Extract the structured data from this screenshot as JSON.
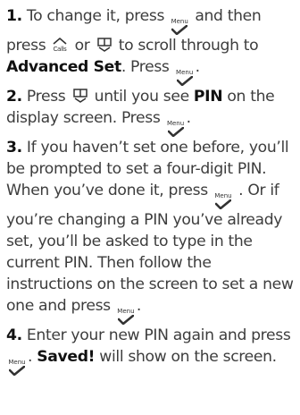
{
  "icons": {
    "menu_key": "menu-check-icon",
    "calls_key": "calls-scroll-up-icon",
    "book_key": "phonebook-scroll-down-icon",
    "menu_label": "Menu"
  },
  "steps": [
    {
      "number": "1.",
      "t1": "To change it, press",
      "t2": "and then press",
      "t3": "or",
      "t4": "to scroll through to",
      "b1": "Advanced Set",
      "t5": ". Press",
      "t6": "."
    },
    {
      "number": "2.",
      "t1": "Press",
      "t2": "until you see",
      "b1": "PIN",
      "t3": "on the display screen. Press",
      "t4": "."
    },
    {
      "number": "3.",
      "t1": "If you haven’t set one before, you’ll be prompted to set a four-digit PIN. When you’ve done it, press",
      "t2": ". Or if you’re changing a PIN you’ve already set, you’ll be asked to type in the current PIN. Then follow the instructions on the screen to set a new one and press",
      "t3": "."
    },
    {
      "number": "4.",
      "t1": "Enter your new PIN again and press",
      "t2": ".",
      "b1": "Saved!",
      "t3": "will show on the screen."
    }
  ]
}
